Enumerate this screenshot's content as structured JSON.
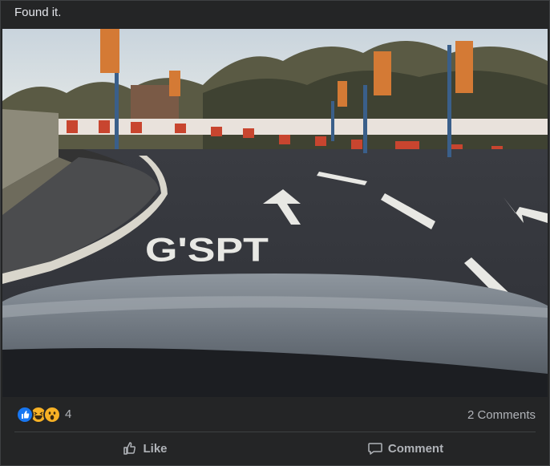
{
  "post": {
    "text": "Found it."
  },
  "photo": {
    "road_text": "G'SPT"
  },
  "reactions": {
    "icons": [
      "like-icon",
      "haha-icon",
      "wow-icon"
    ],
    "count": "4",
    "comments": "2 Comments"
  },
  "actions": {
    "like_label": "Like",
    "comment_label": "Comment"
  },
  "colors": {
    "background": "#242526",
    "text_primary": "#e4e6eb",
    "text_secondary": "#b0b3b8",
    "like_blue": "#1877f2",
    "reaction_yellow": "#f7b125"
  }
}
